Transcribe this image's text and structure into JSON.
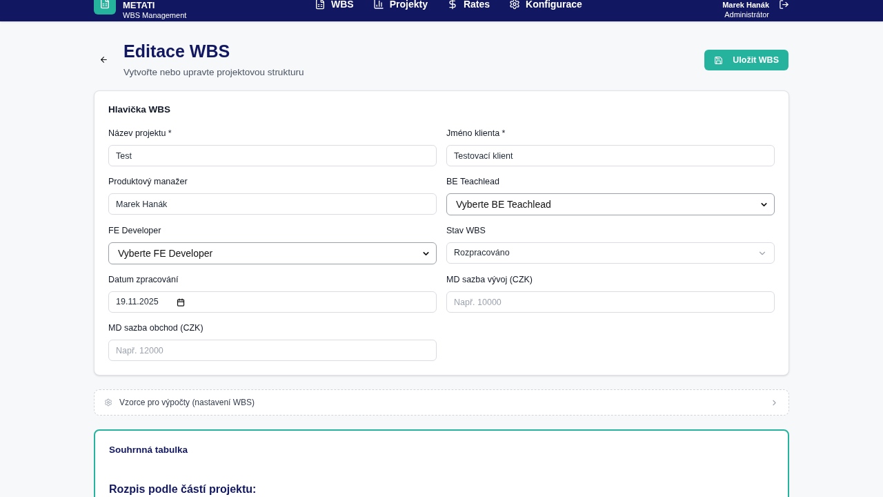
{
  "header": {
    "brand": "METATI",
    "subtitle": "WBS Management",
    "nav": [
      {
        "label": "WBS"
      },
      {
        "label": "Projekty"
      },
      {
        "label": "Rates"
      },
      {
        "label": "Konfigurace"
      }
    ],
    "user": {
      "name": "Marek Hanák",
      "role": "Administrátor"
    }
  },
  "page": {
    "title": "Editace WBS",
    "subtitle": "Vytvořte nebo upravte projektovou strukturu",
    "save_button": "Uložit WBS"
  },
  "form": {
    "title": "Hlavička WBS",
    "fields": [
      {
        "label": "Název projektu *",
        "kind": "text",
        "value": "Test"
      },
      {
        "label": "Jméno klienta *",
        "kind": "text",
        "value": "Testovací klient"
      },
      {
        "label": "Produktový manažer",
        "kind": "text",
        "value": "Marek Hanák"
      },
      {
        "label": "BE Teachlead",
        "kind": "native-select",
        "value": "Vyberte BE Teachlead"
      },
      {
        "label": "FE Developer",
        "kind": "native-select",
        "value": "Vyberte FE Developer"
      },
      {
        "label": "Stav WBS",
        "kind": "select",
        "value": "Rozpracováno"
      },
      {
        "label": "Datum zpracování",
        "kind": "date",
        "value": "19.11.2025"
      },
      {
        "label": "MD sazba vývoj (CZK)",
        "kind": "text",
        "placeholder": "Např. 10000"
      },
      {
        "label": "MD sazba obchod (CZK)",
        "kind": "text",
        "placeholder": "Např. 12000"
      }
    ]
  },
  "formulas": {
    "label": "Vzorce pro výpočty (nastavení WBS)",
    "expanded": false
  },
  "summary": {
    "title": "Souhrnná tabulka",
    "section": "Rozpis podle částí projektu:"
  }
}
